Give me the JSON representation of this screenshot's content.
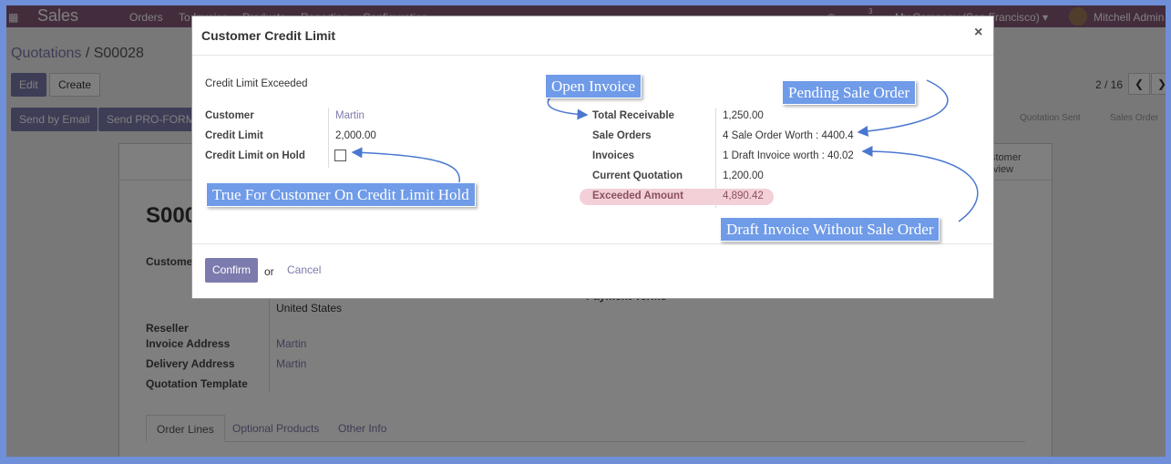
{
  "topbar": {
    "app_title": "Sales",
    "menu": [
      "Orders",
      "To Invoice",
      "Products",
      "Reporting",
      "Configuration"
    ],
    "message_count": "3",
    "company": "My Company (San Francisco)",
    "user": "Mitchell Admin"
  },
  "breadcrumb": {
    "parent": "Quotations",
    "sep": " / ",
    "current": "S00028"
  },
  "buttons": {
    "edit": "Edit",
    "create": "Create",
    "send_email": "Send by Email",
    "send_proforma": "Send PRO-FORM"
  },
  "pager": {
    "text": "2 / 16"
  },
  "statusbar": {
    "quotation_sent": "Quotation Sent",
    "sales_order": "Sales Order"
  },
  "smart_button": {
    "line1": "stomer",
    "line2": "view"
  },
  "sheet": {
    "name": "S000",
    "customer_label": "Custome",
    "customer_country": "United States",
    "payment_terms_label": "Payment Terms",
    "reseller_label": "Reseller",
    "invoice_address_label": "Invoice Address",
    "invoice_address": "Martin",
    "delivery_address_label": "Delivery Address",
    "delivery_address": "Martin",
    "quotation_template_label": "Quotation Template",
    "tabs": [
      "Order Lines",
      "Optional Products",
      "Other Info"
    ]
  },
  "modal": {
    "title": "Customer Credit Limit",
    "close": "×",
    "heading": "Credit Limit Exceeded",
    "customer_label": "Customer",
    "customer_value": "Martin",
    "credit_limit_label": "Credit Limit",
    "credit_limit_value": "2,000.00",
    "on_hold_label": "Credit Limit on Hold",
    "total_receivable_label": "Total Receivable",
    "total_receivable_value": "1,250.00",
    "sale_orders_label": "Sale Orders",
    "sale_orders_value": "4 Sale Order Worth : 4400.4",
    "invoices_label": "Invoices",
    "invoices_value": "1 Draft Invoice worth : 40.02",
    "current_quotation_label": "Current Quotation",
    "current_quotation_value": "1,200.00",
    "exceeded_label": "Exceeded Amount",
    "exceeded_value": "4,890.42",
    "confirm": "Confirm",
    "or": "or",
    "cancel": "Cancel"
  },
  "annotations": {
    "open_invoice": "Open Invoice",
    "pending_sale_order": "Pending Sale Order",
    "credit_hold": "True For Customer On Credit Limit Hold",
    "draft_invoice": "Draft Invoice Without Sale Order"
  },
  "colors": {
    "brand": "#875a7b",
    "primary_button": "#7c7bad",
    "callout": "#6f9be8",
    "exceeded_highlight": "#f3cfd8"
  }
}
